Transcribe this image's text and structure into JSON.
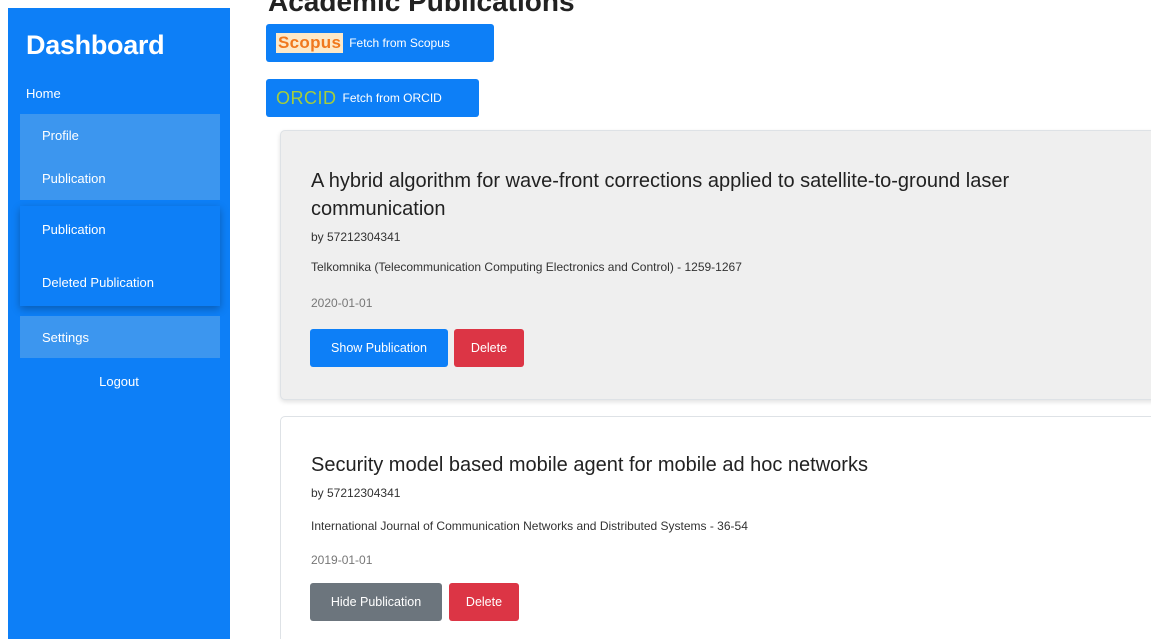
{
  "sidebar": {
    "brand": "Dashboard",
    "home": "Home",
    "items": {
      "profile": "Profile",
      "publication_group": "Publication",
      "publication": "Publication",
      "deleted_publication": "Deleted Publication",
      "settings": "Settings"
    },
    "logout": "Logout"
  },
  "header": {
    "title": "Academic Publications"
  },
  "fetch": {
    "scopus_logo": "Scopus",
    "scopus_label": "Fetch from Scopus",
    "orcid_logo": "ORCID",
    "orcid_label": "Fetch from ORCID"
  },
  "publications": [
    {
      "title": "A hybrid algorithm for wave-front corrections applied to satellite-to-ground laser communication",
      "author": "by 57212304341",
      "journal": "Telkomnika (Telecommunication Computing Electronics and Control) - 1259-1267",
      "date": "2020-01-01",
      "toggle_label": "Show Publication",
      "delete_label": "Delete"
    },
    {
      "title": "Security model based mobile agent for mobile ad hoc networks",
      "author": "by 57212304341",
      "journal": "International Journal of Communication Networks and Distributed Systems - 36-54",
      "date": "2019-01-01",
      "toggle_label": "Hide Publication",
      "delete_label": "Delete"
    }
  ],
  "colors": {
    "primary": "#0d7ff7",
    "danger": "#dc3545",
    "secondary": "#6c757d",
    "scopus_orange": "#f0781d",
    "orcid_green": "#a5cd3c"
  }
}
